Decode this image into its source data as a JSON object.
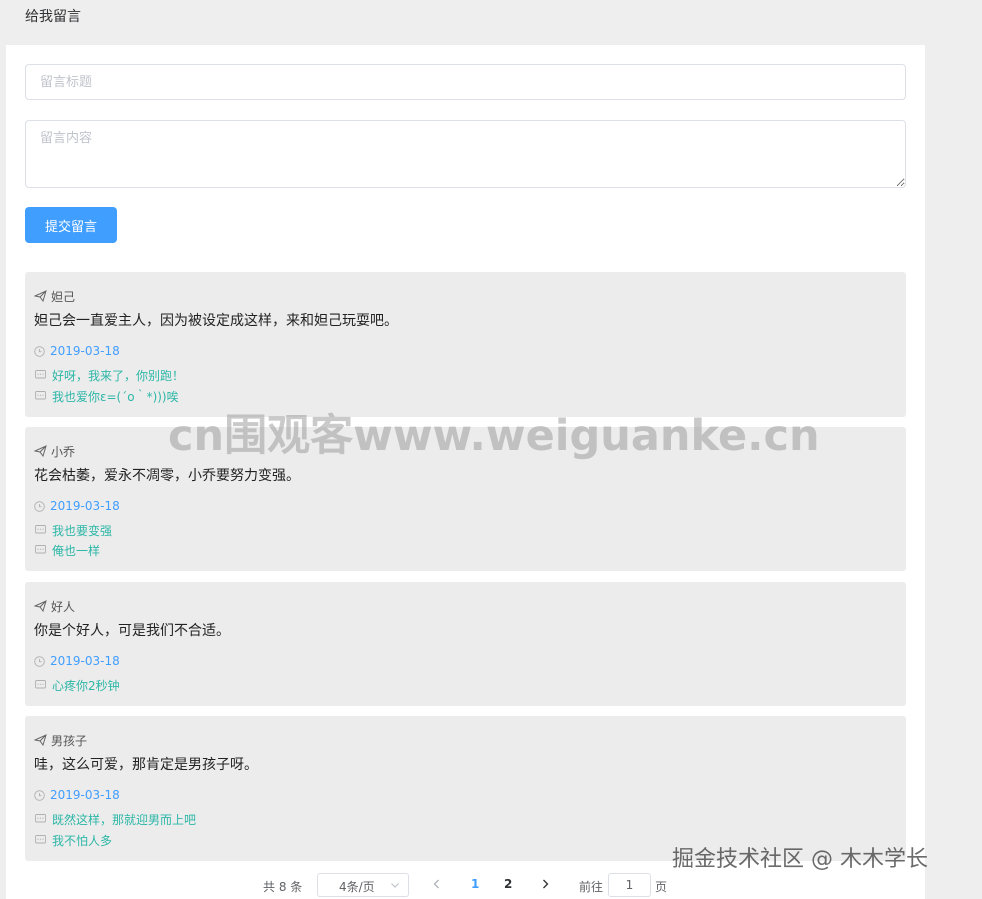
{
  "page": {
    "title": "给我留言"
  },
  "form": {
    "title_placeholder": "留言标题",
    "content_placeholder": "留言内容",
    "submit_label": "提交留言"
  },
  "messages": [
    {
      "author": "妲己",
      "content": "妲己会一直爱主人，因为被设定成这样，来和妲己玩耍吧。",
      "date": "2019-03-18",
      "replies": [
        "好呀，我来了，你别跑！",
        "我也爱你ε=(´ο｀*)))唉"
      ]
    },
    {
      "author": "小乔",
      "content": "花会枯萎，爱永不凋零，小乔要努力变强。",
      "date": "2019-03-18",
      "replies": [
        "我也要变强",
        "俺也一样"
      ]
    },
    {
      "author": "好人",
      "content": "你是个好人，可是我们不合适。",
      "date": "2019-03-18",
      "replies": [
        "心疼你2秒钟"
      ]
    },
    {
      "author": "男孩子",
      "content": "哇，这么可爱，那肯定是男孩子呀。",
      "date": "2019-03-18",
      "replies": [
        "既然这样，那就迎男而上吧",
        "我不怕人多"
      ]
    }
  ],
  "pagination": {
    "total_label": "共 8 条",
    "page_size": "4条/页",
    "pages": [
      "1",
      "2"
    ],
    "current_page": "1",
    "goto_label": "前往",
    "goto_value": "1",
    "page_unit": "页"
  },
  "watermarks": {
    "center": "cn围观客www.weiguanke.cn",
    "corner": "掘金技术社区 @ 木木学长"
  },
  "colors": {
    "primary": "#409eff",
    "reply": "#2db7a7",
    "card_bg": "#ececec"
  }
}
